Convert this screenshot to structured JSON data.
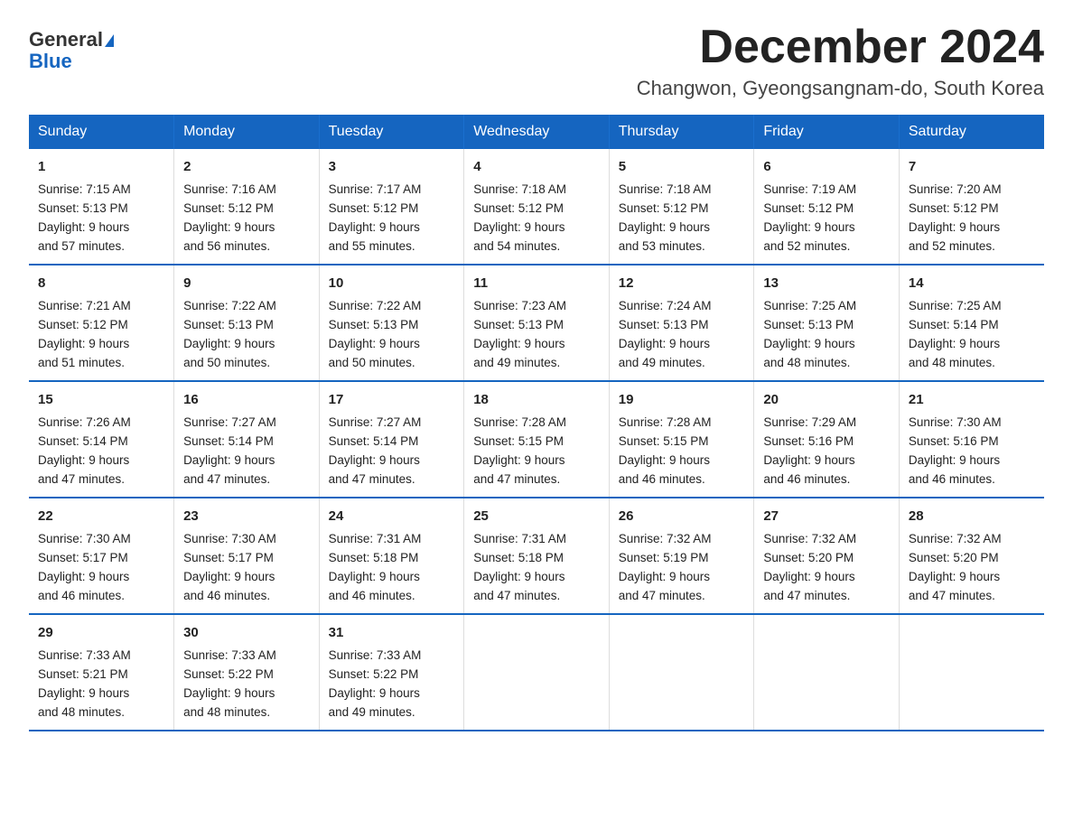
{
  "header": {
    "logo_line1": "General",
    "logo_line2": "Blue",
    "title": "December 2024",
    "subtitle": "Changwon, Gyeongsangnam-do, South Korea"
  },
  "days_of_week": [
    "Sunday",
    "Monday",
    "Tuesday",
    "Wednesday",
    "Thursday",
    "Friday",
    "Saturday"
  ],
  "weeks": [
    [
      {
        "day": "1",
        "lines": [
          "Sunrise: 7:15 AM",
          "Sunset: 5:13 PM",
          "Daylight: 9 hours",
          "and 57 minutes."
        ]
      },
      {
        "day": "2",
        "lines": [
          "Sunrise: 7:16 AM",
          "Sunset: 5:12 PM",
          "Daylight: 9 hours",
          "and 56 minutes."
        ]
      },
      {
        "day": "3",
        "lines": [
          "Sunrise: 7:17 AM",
          "Sunset: 5:12 PM",
          "Daylight: 9 hours",
          "and 55 minutes."
        ]
      },
      {
        "day": "4",
        "lines": [
          "Sunrise: 7:18 AM",
          "Sunset: 5:12 PM",
          "Daylight: 9 hours",
          "and 54 minutes."
        ]
      },
      {
        "day": "5",
        "lines": [
          "Sunrise: 7:18 AM",
          "Sunset: 5:12 PM",
          "Daylight: 9 hours",
          "and 53 minutes."
        ]
      },
      {
        "day": "6",
        "lines": [
          "Sunrise: 7:19 AM",
          "Sunset: 5:12 PM",
          "Daylight: 9 hours",
          "and 52 minutes."
        ]
      },
      {
        "day": "7",
        "lines": [
          "Sunrise: 7:20 AM",
          "Sunset: 5:12 PM",
          "Daylight: 9 hours",
          "and 52 minutes."
        ]
      }
    ],
    [
      {
        "day": "8",
        "lines": [
          "Sunrise: 7:21 AM",
          "Sunset: 5:12 PM",
          "Daylight: 9 hours",
          "and 51 minutes."
        ]
      },
      {
        "day": "9",
        "lines": [
          "Sunrise: 7:22 AM",
          "Sunset: 5:13 PM",
          "Daylight: 9 hours",
          "and 50 minutes."
        ]
      },
      {
        "day": "10",
        "lines": [
          "Sunrise: 7:22 AM",
          "Sunset: 5:13 PM",
          "Daylight: 9 hours",
          "and 50 minutes."
        ]
      },
      {
        "day": "11",
        "lines": [
          "Sunrise: 7:23 AM",
          "Sunset: 5:13 PM",
          "Daylight: 9 hours",
          "and 49 minutes."
        ]
      },
      {
        "day": "12",
        "lines": [
          "Sunrise: 7:24 AM",
          "Sunset: 5:13 PM",
          "Daylight: 9 hours",
          "and 49 minutes."
        ]
      },
      {
        "day": "13",
        "lines": [
          "Sunrise: 7:25 AM",
          "Sunset: 5:13 PM",
          "Daylight: 9 hours",
          "and 48 minutes."
        ]
      },
      {
        "day": "14",
        "lines": [
          "Sunrise: 7:25 AM",
          "Sunset: 5:14 PM",
          "Daylight: 9 hours",
          "and 48 minutes."
        ]
      }
    ],
    [
      {
        "day": "15",
        "lines": [
          "Sunrise: 7:26 AM",
          "Sunset: 5:14 PM",
          "Daylight: 9 hours",
          "and 47 minutes."
        ]
      },
      {
        "day": "16",
        "lines": [
          "Sunrise: 7:27 AM",
          "Sunset: 5:14 PM",
          "Daylight: 9 hours",
          "and 47 minutes."
        ]
      },
      {
        "day": "17",
        "lines": [
          "Sunrise: 7:27 AM",
          "Sunset: 5:14 PM",
          "Daylight: 9 hours",
          "and 47 minutes."
        ]
      },
      {
        "day": "18",
        "lines": [
          "Sunrise: 7:28 AM",
          "Sunset: 5:15 PM",
          "Daylight: 9 hours",
          "and 47 minutes."
        ]
      },
      {
        "day": "19",
        "lines": [
          "Sunrise: 7:28 AM",
          "Sunset: 5:15 PM",
          "Daylight: 9 hours",
          "and 46 minutes."
        ]
      },
      {
        "day": "20",
        "lines": [
          "Sunrise: 7:29 AM",
          "Sunset: 5:16 PM",
          "Daylight: 9 hours",
          "and 46 minutes."
        ]
      },
      {
        "day": "21",
        "lines": [
          "Sunrise: 7:30 AM",
          "Sunset: 5:16 PM",
          "Daylight: 9 hours",
          "and 46 minutes."
        ]
      }
    ],
    [
      {
        "day": "22",
        "lines": [
          "Sunrise: 7:30 AM",
          "Sunset: 5:17 PM",
          "Daylight: 9 hours",
          "and 46 minutes."
        ]
      },
      {
        "day": "23",
        "lines": [
          "Sunrise: 7:30 AM",
          "Sunset: 5:17 PM",
          "Daylight: 9 hours",
          "and 46 minutes."
        ]
      },
      {
        "day": "24",
        "lines": [
          "Sunrise: 7:31 AM",
          "Sunset: 5:18 PM",
          "Daylight: 9 hours",
          "and 46 minutes."
        ]
      },
      {
        "day": "25",
        "lines": [
          "Sunrise: 7:31 AM",
          "Sunset: 5:18 PM",
          "Daylight: 9 hours",
          "and 47 minutes."
        ]
      },
      {
        "day": "26",
        "lines": [
          "Sunrise: 7:32 AM",
          "Sunset: 5:19 PM",
          "Daylight: 9 hours",
          "and 47 minutes."
        ]
      },
      {
        "day": "27",
        "lines": [
          "Sunrise: 7:32 AM",
          "Sunset: 5:20 PM",
          "Daylight: 9 hours",
          "and 47 minutes."
        ]
      },
      {
        "day": "28",
        "lines": [
          "Sunrise: 7:32 AM",
          "Sunset: 5:20 PM",
          "Daylight: 9 hours",
          "and 47 minutes."
        ]
      }
    ],
    [
      {
        "day": "29",
        "lines": [
          "Sunrise: 7:33 AM",
          "Sunset: 5:21 PM",
          "Daylight: 9 hours",
          "and 48 minutes."
        ]
      },
      {
        "day": "30",
        "lines": [
          "Sunrise: 7:33 AM",
          "Sunset: 5:22 PM",
          "Daylight: 9 hours",
          "and 48 minutes."
        ]
      },
      {
        "day": "31",
        "lines": [
          "Sunrise: 7:33 AM",
          "Sunset: 5:22 PM",
          "Daylight: 9 hours",
          "and 49 minutes."
        ]
      },
      null,
      null,
      null,
      null
    ]
  ]
}
